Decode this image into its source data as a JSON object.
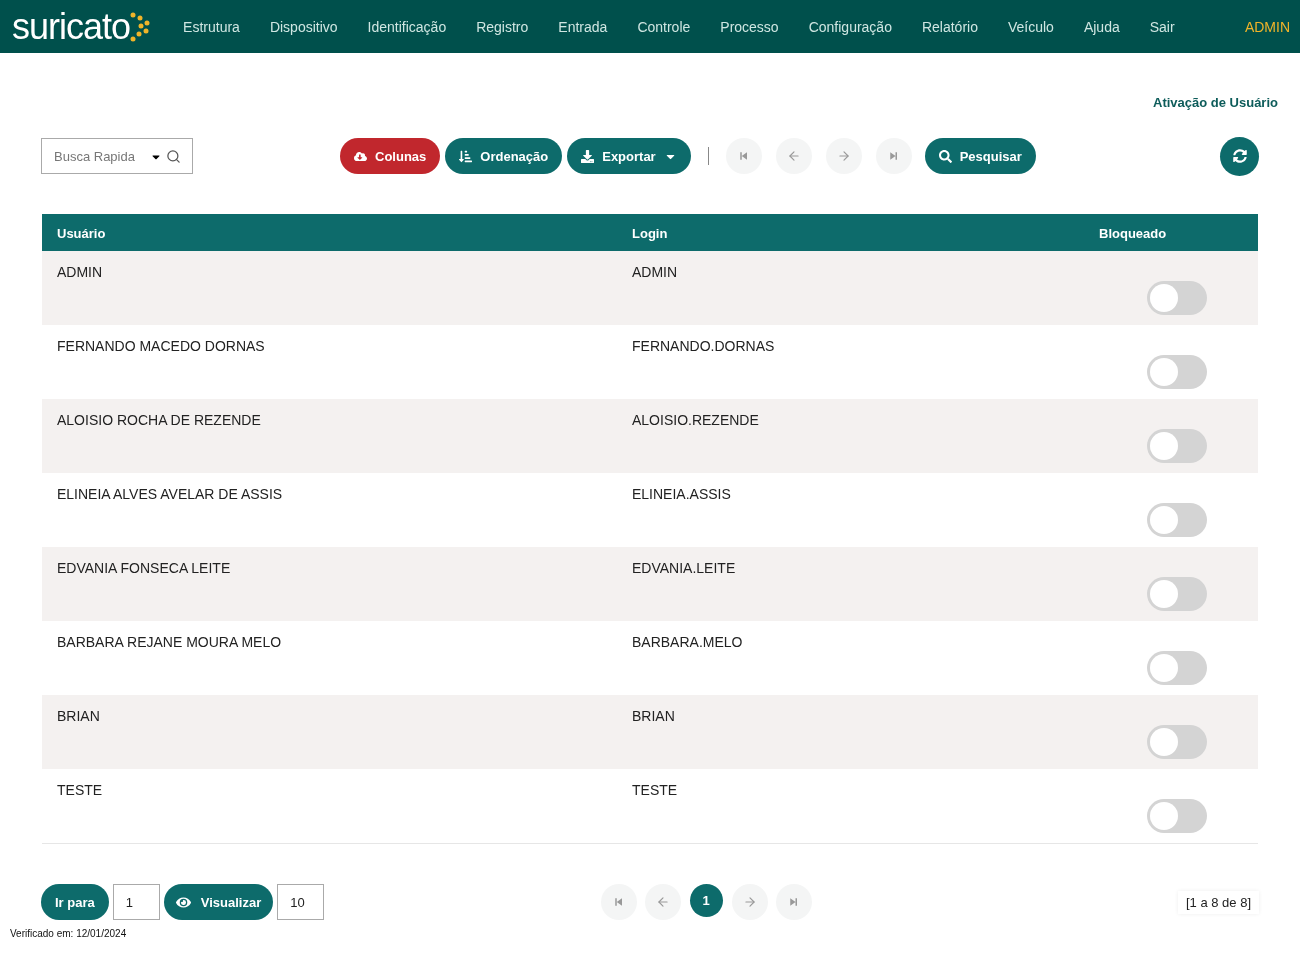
{
  "nav": {
    "logo": "suricato",
    "items": [
      "Estrutura",
      "Dispositivo",
      "Identificação",
      "Registro",
      "Entrada",
      "Controle",
      "Processo",
      "Configuração",
      "Relatório",
      "Veículo",
      "Ajuda",
      "Sair"
    ],
    "user": "ADMIN"
  },
  "page_title": "Ativação de Usuário",
  "toolbar": {
    "search": {
      "placeholder": "Busca Rapida"
    },
    "buttons": [
      {
        "label": "Colunas",
        "kind": "danger"
      },
      {
        "label": "Ordenação",
        "kind": "primary"
      },
      {
        "label": "Exportar",
        "kind": "dropdown"
      }
    ],
    "search_button": "Pesquisar"
  },
  "table": {
    "columns": [
      "Usuário",
      "Login",
      "Bloqueado"
    ],
    "rows": [
      {
        "user": "ADMIN",
        "login": "ADMIN",
        "blocked": false
      },
      {
        "user": "FERNANDO MACEDO DORNAS",
        "login": "FERNANDO.DORNAS",
        "blocked": false
      },
      {
        "user": "ALOISIO ROCHA DE REZENDE",
        "login": "ALOISIO.REZENDE",
        "blocked": false
      },
      {
        "user": "ELINEIA ALVES AVELAR DE ASSIS",
        "login": "ELINEIA.ASSIS",
        "blocked": false
      },
      {
        "user": "EDVANIA FONSECA LEITE",
        "login": "EDVANIA.LEITE",
        "blocked": false
      },
      {
        "user": "BARBARA REJANE MOURA MELO",
        "login": "BARBARA.MELO",
        "blocked": false
      },
      {
        "user": "BRIAN",
        "login": "BRIAN",
        "blocked": false
      },
      {
        "user": "TESTE",
        "login": "TESTE",
        "blocked": false
      }
    ]
  },
  "footer": {
    "goto_button": "Ir para",
    "goto_value": "1",
    "view_button": "Visualizar",
    "view_value": "10",
    "pages": [
      {
        "label": "1",
        "selected": true
      }
    ],
    "range": "[1 a 8 de 8]",
    "verified": "Verificado em: 12/01/2024"
  }
}
